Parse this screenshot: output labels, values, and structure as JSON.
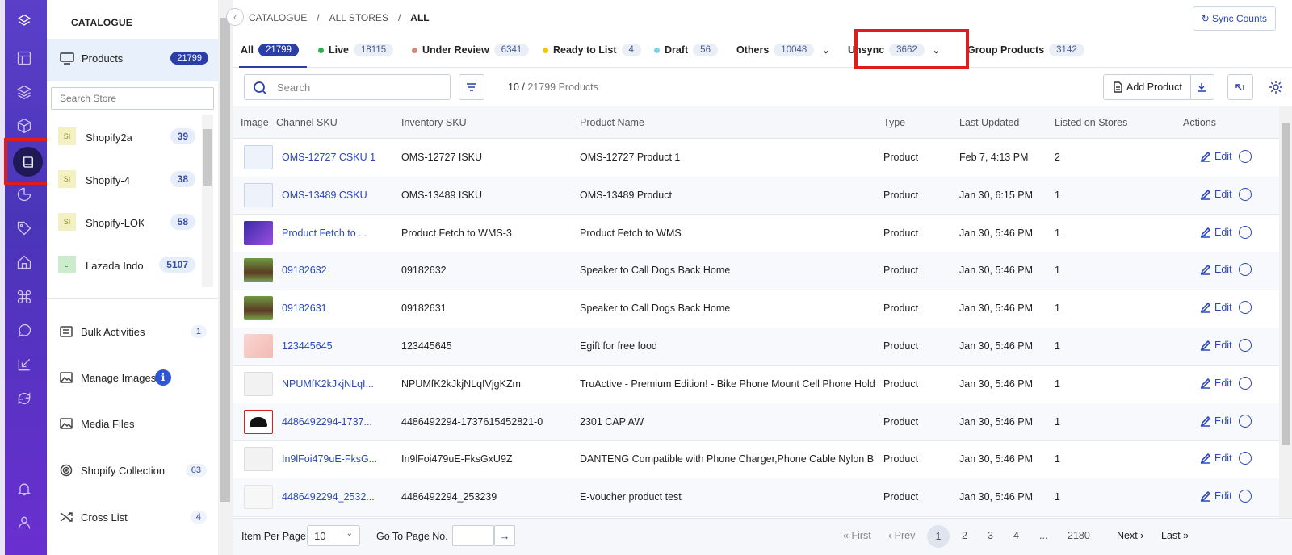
{
  "breadcrumb": [
    "CATALOGUE",
    "ALL STORES",
    "ALL"
  ],
  "sync_button": "Sync Counts",
  "sidebar": {
    "title": "CATALOGUE",
    "products_label": "Products",
    "products_count": "21799",
    "search_placeholder": "Search Store",
    "stores": [
      {
        "tag": "SI",
        "name": "Shopify2a",
        "count": "39",
        "color": "#f3f1c2",
        "tcolor": "#8a8a2a"
      },
      {
        "tag": "SI",
        "name": "Shopify-4",
        "count": "38",
        "color": "#f3f1c2",
        "tcolor": "#8a8a2a"
      },
      {
        "tag": "SI",
        "name": "Shopify-LOK",
        "count": "58",
        "color": "#f3f1c2",
        "tcolor": "#8a8a2a"
      },
      {
        "tag": "LI",
        "name": "Lazada Indor",
        "count": "5107",
        "color": "#cdeccd",
        "tcolor": "#3b8b3b"
      }
    ],
    "items": [
      {
        "label": "Bulk Activities",
        "count": "1"
      },
      {
        "label": "Manage Images",
        "count": ""
      },
      {
        "label": "Media Files",
        "count": ""
      },
      {
        "label": "Shopify Collection",
        "count": "63"
      },
      {
        "label": "Cross List",
        "count": "4"
      }
    ]
  },
  "tabs": [
    {
      "label": "All",
      "count": "21799",
      "dot": ""
    },
    {
      "label": "Live",
      "count": "18115",
      "dot": "#2db34a"
    },
    {
      "label": "Under Review",
      "count": "6341",
      "dot": "#c98c7a"
    },
    {
      "label": "Ready to List",
      "count": "4",
      "dot": "#f2c40f"
    },
    {
      "label": "Draft",
      "count": "56",
      "dot": "#7fd3e0"
    },
    {
      "label": "Others",
      "count": "10048",
      "dot": ""
    },
    {
      "label": "Unsync",
      "count": "3662",
      "dot": ""
    },
    {
      "label": "Group Products",
      "count": "3142",
      "dot": ""
    }
  ],
  "toolbar": {
    "search_placeholder": "Search",
    "count_shown": "10 /",
    "count_total": "21799 Products",
    "add_product": "Add Product"
  },
  "columns": [
    "Image",
    "Channel SKU",
    "Inventory SKU",
    "Product Name",
    "Type",
    "Last Updated",
    "Listed on Stores",
    "Actions"
  ],
  "rows": [
    {
      "channel_sku": "OMS-12727 CSKU 1",
      "inventory_sku": "OMS-12727 ISKU",
      "name": "OMS-12727 Product 1",
      "type": "Product",
      "updated": "Feb 7, 4:13 PM",
      "listed": "2",
      "img": "placeholder"
    },
    {
      "channel_sku": "OMS-13489 CSKU",
      "inventory_sku": "OMS-13489 ISKU",
      "name": "OMS-13489 Product",
      "type": "Product",
      "updated": "Jan 30, 6:15 PM",
      "listed": "1",
      "img": "placeholder"
    },
    {
      "channel_sku": "Product Fetch to ...",
      "inventory_sku": "Product Fetch to WMS-3",
      "name": "Product Fetch to WMS",
      "type": "Product",
      "updated": "Jan 30, 5:46 PM",
      "listed": "1",
      "img": "purple"
    },
    {
      "channel_sku": "09182632",
      "inventory_sku": "09182632",
      "name": "Speaker to Call Dogs Back Home",
      "type": "Product",
      "updated": "Jan 30, 5:46 PM",
      "listed": "1",
      "img": "dog"
    },
    {
      "channel_sku": "09182631",
      "inventory_sku": "09182631",
      "name": "Speaker to Call Dogs Back Home",
      "type": "Product",
      "updated": "Jan 30, 5:46 PM",
      "listed": "1",
      "img": "dog"
    },
    {
      "channel_sku": "123445645",
      "inventory_sku": "123445645",
      "name": "Egift for free food",
      "type": "Product",
      "updated": "Jan 30, 5:46 PM",
      "listed": "1",
      "img": "pink"
    },
    {
      "channel_sku": "NPUMfK2kJkjNLqI...",
      "inventory_sku": "NPUMfK2kJkjNLqIVjgKZm",
      "name": "TruActive - Premium Edition! - Bike Phone Mount Cell Phone Holder f...",
      "type": "Product",
      "updated": "Jan 30, 5:46 PM",
      "listed": "1",
      "img": "gray"
    },
    {
      "channel_sku": "4486492294-1737...",
      "inventory_sku": "4486492294-1737615452821-0",
      "name": "2301 CAP AW",
      "type": "Product",
      "updated": "Jan 30, 5:46 PM",
      "listed": "1",
      "img": "cap"
    },
    {
      "channel_sku": "In9lFoi479uE-FksG...",
      "inventory_sku": "In9lFoi479uE-FksGxU9Z",
      "name": "DANTENG Compatible with Phone Charger,Phone Cable Nylon Braided",
      "type": "Product",
      "updated": "Jan 30, 5:46 PM",
      "listed": "1",
      "img": "gray"
    },
    {
      "channel_sku": "4486492294_2532...",
      "inventory_sku": "4486492294_253239",
      "name": "E-voucher product test",
      "type": "Product",
      "updated": "Jan 30, 5:46 PM",
      "listed": "1",
      "img": "light"
    }
  ],
  "edit_label": "Edit",
  "footer": {
    "item_per_page": "Item Per Page",
    "per_page_value": "10",
    "go_to_page": "Go To Page No.",
    "first": "First",
    "prev": "Prev",
    "pages": [
      "1",
      "2",
      "3",
      "4",
      "...",
      "2180"
    ],
    "next": "Next",
    "last": "Last"
  }
}
